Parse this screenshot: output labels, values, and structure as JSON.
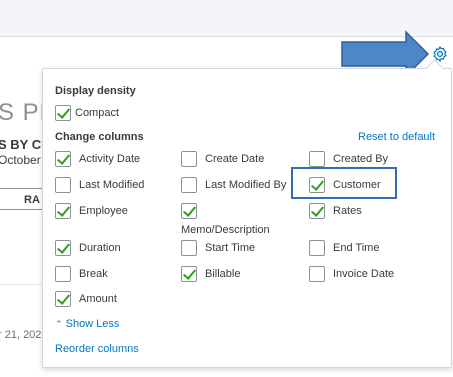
{
  "background": {
    "report_title_fragment": "S PLU",
    "report_subtitle_fragment": "S BY CU",
    "date_range_fragment": "October",
    "button_fragment": "RA",
    "row_date_fragment": "r 21, 202"
  },
  "gear": {
    "icon": "gear-icon",
    "color": "#0077c5"
  },
  "arrow": {
    "color": "#4f86c6"
  },
  "panel": {
    "display_density_title": "Display density",
    "compact": {
      "label": "Compact",
      "checked": true
    },
    "change_columns_title": "Change columns",
    "reset_label": "Reset to default",
    "columns": [
      {
        "label": "Activity Date",
        "checked": true
      },
      {
        "label": "Create Date",
        "checked": false
      },
      {
        "label": "Created By",
        "checked": false
      },
      {
        "label": "Last Modified",
        "checked": false
      },
      {
        "label": "Last Modified By",
        "checked": false
      },
      {
        "label": "Customer",
        "checked": true
      },
      {
        "label": "Employee",
        "checked": true
      },
      {
        "label": "Memo/Description",
        "checked": true
      },
      {
        "label": "Rates",
        "checked": true
      },
      {
        "label": "Duration",
        "checked": true
      },
      {
        "label": "Start Time",
        "checked": false
      },
      {
        "label": "End Time",
        "checked": false
      },
      {
        "label": "Break",
        "checked": false
      },
      {
        "label": "Billable",
        "checked": true
      },
      {
        "label": "Invoice Date",
        "checked": false
      },
      {
        "label": "Amount",
        "checked": true
      }
    ],
    "show_less": "Show Less",
    "reorder_columns": "Reorder columns"
  },
  "colors": {
    "link": "#0077c5",
    "check": "#2ca01c",
    "highlight": "#2f6db5"
  }
}
